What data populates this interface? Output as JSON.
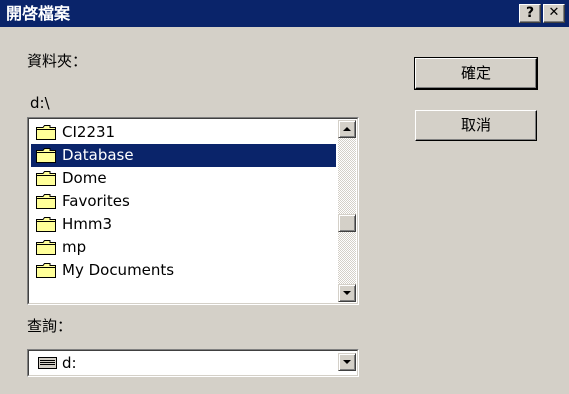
{
  "window": {
    "title": "開啓檔案"
  },
  "titlebar": {
    "help_label": "?",
    "close_label": "✕"
  },
  "folders_label": "資料夾：",
  "current_path": "d:\\",
  "buttons": {
    "ok": "確定",
    "cancel": "取消"
  },
  "folders": [
    {
      "name": "CI2231",
      "selected": false
    },
    {
      "name": "Database",
      "selected": true
    },
    {
      "name": "Dome",
      "selected": false
    },
    {
      "name": "Favorites",
      "selected": false
    },
    {
      "name": "Hmm3",
      "selected": false
    },
    {
      "name": "mp",
      "selected": false
    },
    {
      "name": "My Documents",
      "selected": false
    }
  ],
  "drives_label": "查詢：",
  "drive": {
    "value": "d:",
    "icon": "drive-icon"
  },
  "icons": {
    "folder": "folder-icon",
    "scroll_up": "up-arrow-icon",
    "scroll_down": "down-arrow-icon"
  },
  "colors": {
    "titlebar": "#0a246a",
    "selection": "#0a246a",
    "face": "#d4d0c8"
  }
}
